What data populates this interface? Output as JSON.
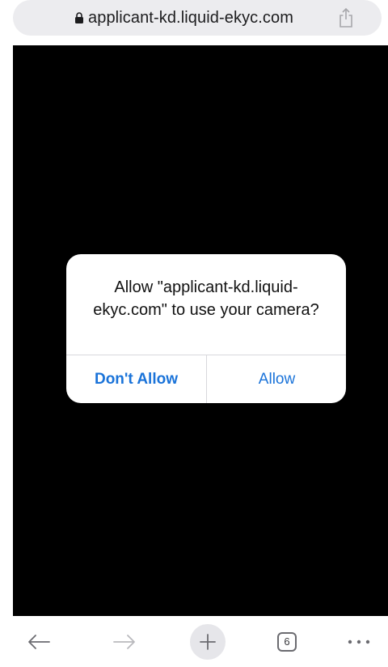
{
  "address_bar": {
    "url": "applicant-kd.liquid-ekyc.com"
  },
  "alert": {
    "title": "Allow \"applicant-kd.liquid-ekyc.com\" to use your camera?",
    "dont_allow_label": "Don't Allow",
    "allow_label": "Allow",
    "accent_color": "#1a73d9"
  },
  "toolbar": {
    "tab_count": "6",
    "icons": [
      "back-arrow-icon",
      "forward-arrow-icon",
      "plus-icon",
      "tabs-icon",
      "more-icon"
    ]
  },
  "colors": {
    "content_background": "#000000",
    "address_pill": "#ececef"
  }
}
